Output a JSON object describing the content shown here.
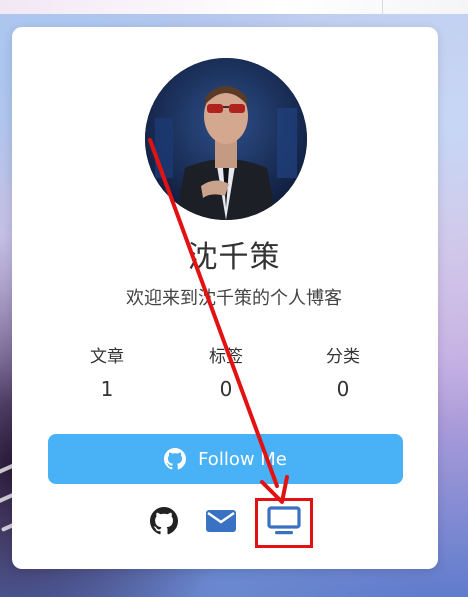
{
  "profile": {
    "name": "沈千策",
    "description": "欢迎来到沈千策的个人博客"
  },
  "stats": [
    {
      "label": "文章",
      "value": "1"
    },
    {
      "label": "标签",
      "value": "0"
    },
    {
      "label": "分类",
      "value": "0"
    }
  ],
  "follow_button": {
    "label": "Follow Me",
    "icon": "github-icon"
  },
  "social_links": [
    {
      "icon": "github-icon"
    },
    {
      "icon": "mail-icon"
    },
    {
      "icon": "desktop-icon"
    }
  ],
  "colors": {
    "accent": "#49b1f5",
    "annotation": "#e31212",
    "text": "#333333",
    "icon_dark": "#222222",
    "icon_blue": "#3a72c3"
  }
}
